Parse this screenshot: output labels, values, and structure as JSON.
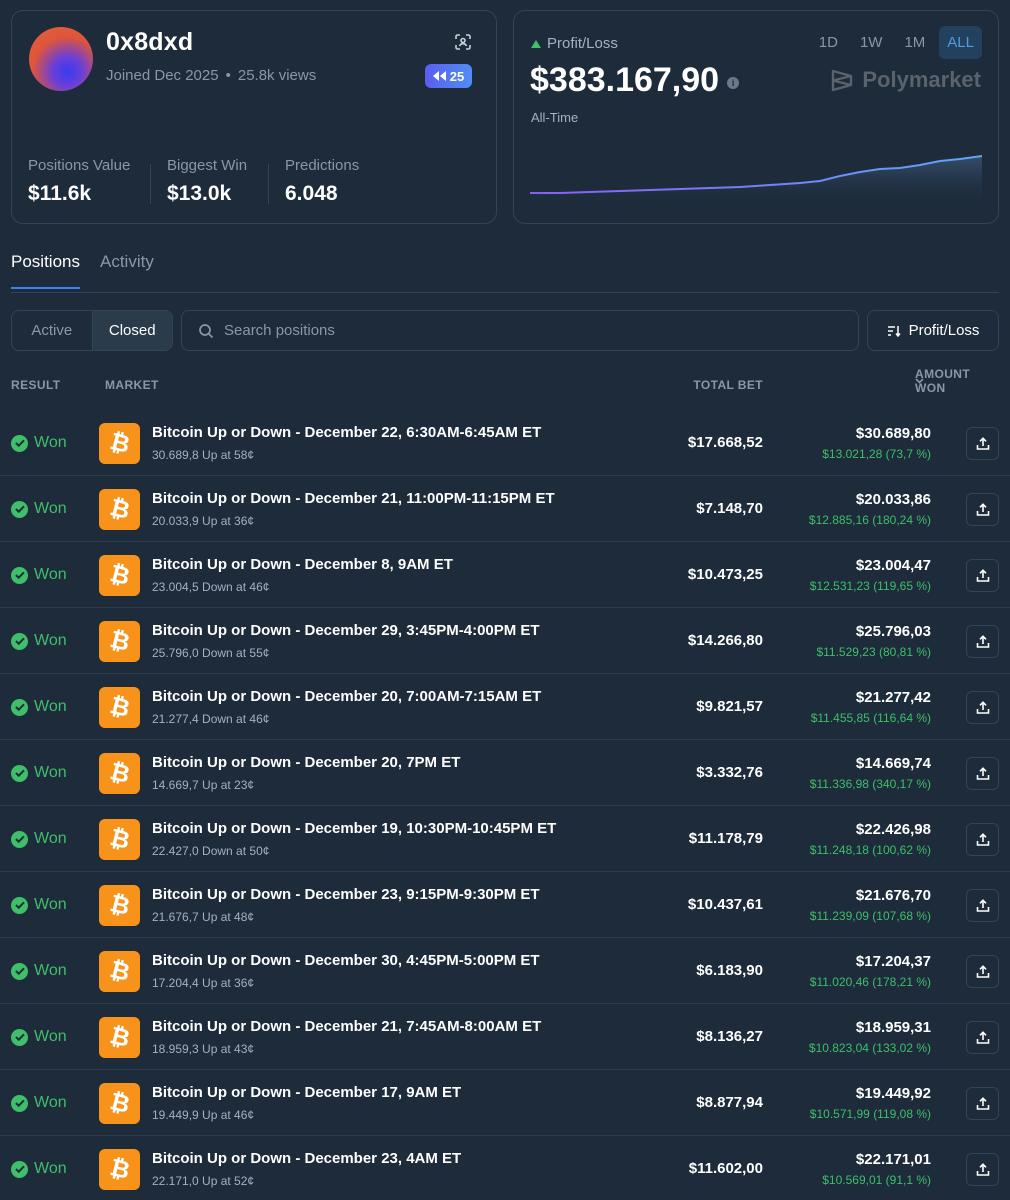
{
  "profile": {
    "username": "0x8dxd",
    "joined": "Joined Dec 2025",
    "separator": "•",
    "views": "25.8k views",
    "badge_count": "25",
    "stats": [
      {
        "label": "Positions Value",
        "value": "$11.6k"
      },
      {
        "label": "Biggest Win",
        "value": "$13.0k"
      },
      {
        "label": "Predictions",
        "value": "6.048"
      }
    ]
  },
  "pnl": {
    "label": "Profit/Loss",
    "value": "$383.167,90",
    "info": "i",
    "period": "All-Time",
    "ranges": [
      "1D",
      "1W",
      "1M",
      "ALL"
    ],
    "active_range": "ALL",
    "brand": "Polymarket",
    "colors": {
      "positive": "#3fbf6a",
      "accent": "#4f9be6",
      "line_start": "#8b5cf6",
      "line_end": "#60a5fa"
    }
  },
  "tabs": [
    "Positions",
    "Activity"
  ],
  "filters": {
    "active": "Active",
    "closed": "Closed"
  },
  "search": {
    "placeholder": "Search positions"
  },
  "sort": {
    "label": "Profit/Loss"
  },
  "columns": {
    "result": "RESULT",
    "market": "MARKET",
    "total_bet": "TOTAL BET",
    "amount_won": "AMOUNT WON"
  },
  "positions": [
    {
      "result": "Won",
      "title": "Bitcoin Up or Down - December 22, 6:30AM-6:45AM ET",
      "detail": "30.689,8 Up at 58¢",
      "total_bet": "$17.668,52",
      "amount_won": "$30.689,80",
      "gain": "$13.021,28 (73,7 %)"
    },
    {
      "result": "Won",
      "title": "Bitcoin Up or Down - December 21, 11:00PM-11:15PM ET",
      "detail": "20.033,9 Up at 36¢",
      "total_bet": "$7.148,70",
      "amount_won": "$20.033,86",
      "gain": "$12.885,16 (180,24 %)"
    },
    {
      "result": "Won",
      "title": "Bitcoin Up or Down - December 8, 9AM ET",
      "detail": "23.004,5 Down at 46¢",
      "total_bet": "$10.473,25",
      "amount_won": "$23.004,47",
      "gain": "$12.531,23 (119,65 %)"
    },
    {
      "result": "Won",
      "title": "Bitcoin Up or Down - December 29, 3:45PM-4:00PM ET",
      "detail": "25.796,0 Down at 55¢",
      "total_bet": "$14.266,80",
      "amount_won": "$25.796,03",
      "gain": "$11.529,23 (80,81 %)"
    },
    {
      "result": "Won",
      "title": "Bitcoin Up or Down - December 20, 7:00AM-7:15AM ET",
      "detail": "21.277,4 Down at 46¢",
      "total_bet": "$9.821,57",
      "amount_won": "$21.277,42",
      "gain": "$11.455,85 (116,64 %)"
    },
    {
      "result": "Won",
      "title": "Bitcoin Up or Down - December 20, 7PM ET",
      "detail": "14.669,7 Up at 23¢",
      "total_bet": "$3.332,76",
      "amount_won": "$14.669,74",
      "gain": "$11.336,98 (340,17 %)"
    },
    {
      "result": "Won",
      "title": "Bitcoin Up or Down - December 19, 10:30PM-10:45PM ET",
      "detail": "22.427,0 Down at 50¢",
      "total_bet": "$11.178,79",
      "amount_won": "$22.426,98",
      "gain": "$11.248,18 (100,62 %)"
    },
    {
      "result": "Won",
      "title": "Bitcoin Up or Down - December 23, 9:15PM-9:30PM ET",
      "detail": "21.676,7 Up at 48¢",
      "total_bet": "$10.437,61",
      "amount_won": "$21.676,70",
      "gain": "$11.239,09 (107,68 %)"
    },
    {
      "result": "Won",
      "title": "Bitcoin Up or Down - December 30, 4:45PM-5:00PM ET",
      "detail": "17.204,4 Up at 36¢",
      "total_bet": "$6.183,90",
      "amount_won": "$17.204,37",
      "gain": "$11.020,46 (178,21 %)"
    },
    {
      "result": "Won",
      "title": "Bitcoin Up or Down - December 21, 7:45AM-8:00AM ET",
      "detail": "18.959,3 Up at 43¢",
      "total_bet": "$8.136,27",
      "amount_won": "$18.959,31",
      "gain": "$10.823,04 (133,02 %)"
    },
    {
      "result": "Won",
      "title": "Bitcoin Up or Down - December 17, 9AM ET",
      "detail": "19.449,9 Up at 46¢",
      "total_bet": "$8.877,94",
      "amount_won": "$19.449,92",
      "gain": "$10.571,99 (119,08 %)"
    },
    {
      "result": "Won",
      "title": "Bitcoin Up or Down - December 23, 4AM ET",
      "detail": "22.171,0 Up at 52¢",
      "total_bet": "$11.602,00",
      "amount_won": "$22.171,01",
      "gain": "$10.569,01 (91,1 %)"
    }
  ]
}
